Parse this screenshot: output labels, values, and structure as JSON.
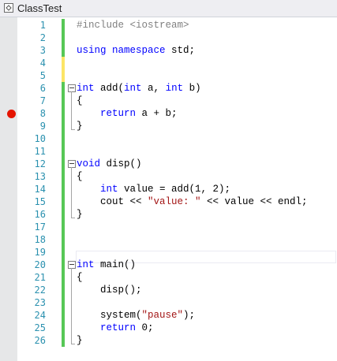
{
  "window": {
    "title": "ClassTest"
  },
  "lines": [
    {
      "num": "1",
      "code": "#include <iostream>",
      "change": "saved"
    },
    {
      "num": "2",
      "code": "",
      "change": "saved"
    },
    {
      "num": "3",
      "code": "using namespace std;",
      "change": "saved"
    },
    {
      "num": "4",
      "code": "",
      "change": "unsaved"
    },
    {
      "num": "5",
      "code": "",
      "change": "unsaved"
    },
    {
      "num": "6",
      "code": "int add(int a, int b)",
      "change": "saved",
      "fold": "start"
    },
    {
      "num": "7",
      "code": "{",
      "change": "saved"
    },
    {
      "num": "8",
      "code": "    return a + b;",
      "change": "saved",
      "breakpoint": true
    },
    {
      "num": "9",
      "code": "}",
      "change": "saved",
      "fold": "end"
    },
    {
      "num": "10",
      "code": "",
      "change": "saved"
    },
    {
      "num": "11",
      "code": "",
      "change": "saved"
    },
    {
      "num": "12",
      "code": "void disp()",
      "change": "saved",
      "fold": "start"
    },
    {
      "num": "13",
      "code": "{",
      "change": "saved"
    },
    {
      "num": "14",
      "code": "    int value = add(1, 2);",
      "change": "saved"
    },
    {
      "num": "15",
      "code": "    cout << \"value: \" << value << endl;",
      "change": "saved"
    },
    {
      "num": "16",
      "code": "}",
      "change": "saved",
      "fold": "end"
    },
    {
      "num": "17",
      "code": "",
      "change": "saved"
    },
    {
      "num": "18",
      "code": "",
      "change": "saved"
    },
    {
      "num": "19",
      "code": "",
      "change": "saved"
    },
    {
      "num": "20",
      "code": "int main()",
      "change": "saved",
      "fold": "start"
    },
    {
      "num": "21",
      "code": "{",
      "change": "saved"
    },
    {
      "num": "22",
      "code": "    disp();",
      "change": "saved"
    },
    {
      "num": "23",
      "code": "",
      "change": "saved"
    },
    {
      "num": "24",
      "code": "    system(\"pause\");",
      "change": "saved"
    },
    {
      "num": "25",
      "code": "    return 0;",
      "change": "saved"
    },
    {
      "num": "26",
      "code": "}",
      "change": "saved",
      "fold": "end"
    }
  ],
  "current_line": "18",
  "colors": {
    "keyword": "#0000ff",
    "preprocessor": "#808080",
    "string": "#a31515",
    "line_number": "#2b91af",
    "change_saved": "#57c756",
    "change_unsaved": "#fce566",
    "breakpoint": "#e51400"
  },
  "icons": {
    "title": "code-file-icon",
    "breakpoint": "breakpoint-icon",
    "fold": "collapse-icon"
  }
}
